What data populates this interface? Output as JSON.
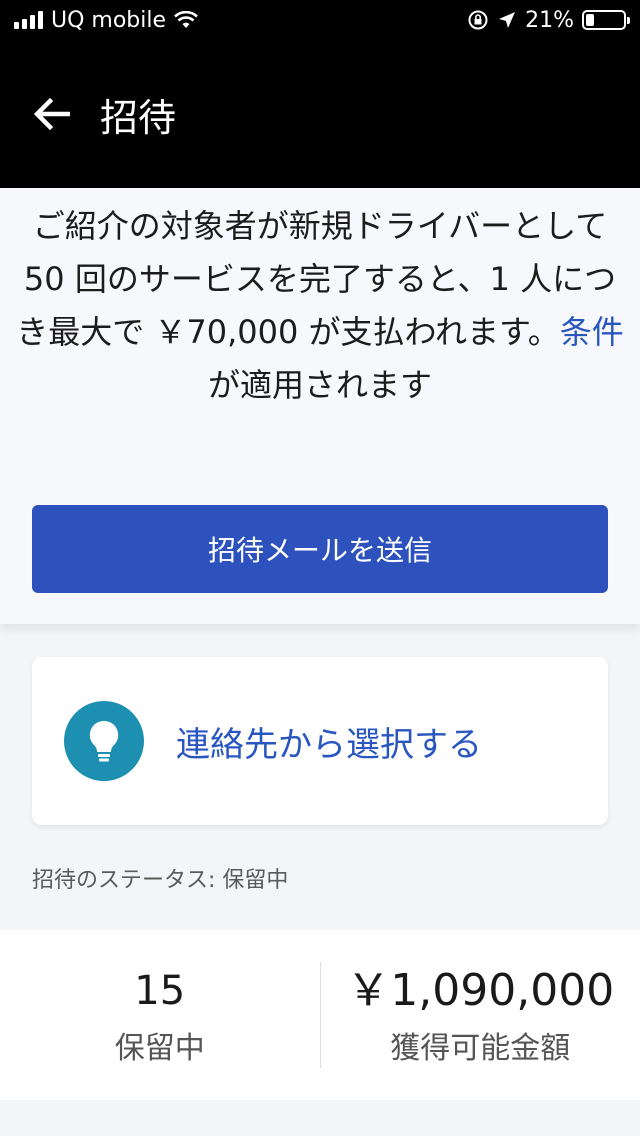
{
  "status_bar": {
    "carrier": "UQ mobile",
    "battery_percent": "21%",
    "battery_level": 0.21
  },
  "header": {
    "title": "招待"
  },
  "invite": {
    "desc_main": "ご紹介の対象者が新規ドライバーとして 50 回のサービスを完了すると、1 人につき最大で ￥70,000 が支払われます。",
    "desc_link": "条件",
    "desc_tail": " が適用されます",
    "send_button": "招待メールを送信"
  },
  "contacts": {
    "label": "連絡先から選択する",
    "icon": "lightbulb-icon"
  },
  "invite_status": "招待のステータス: 保留中",
  "stats": {
    "pending_count": "15",
    "pending_label": "保留中",
    "earnable_amount": "￥1,090,000",
    "earnable_label": "獲得可能金額"
  },
  "colors": {
    "header_bg": "#000000",
    "accent": "#2d52bd",
    "link": "#2a56c0",
    "icon_bg": "#1d8fb0"
  }
}
